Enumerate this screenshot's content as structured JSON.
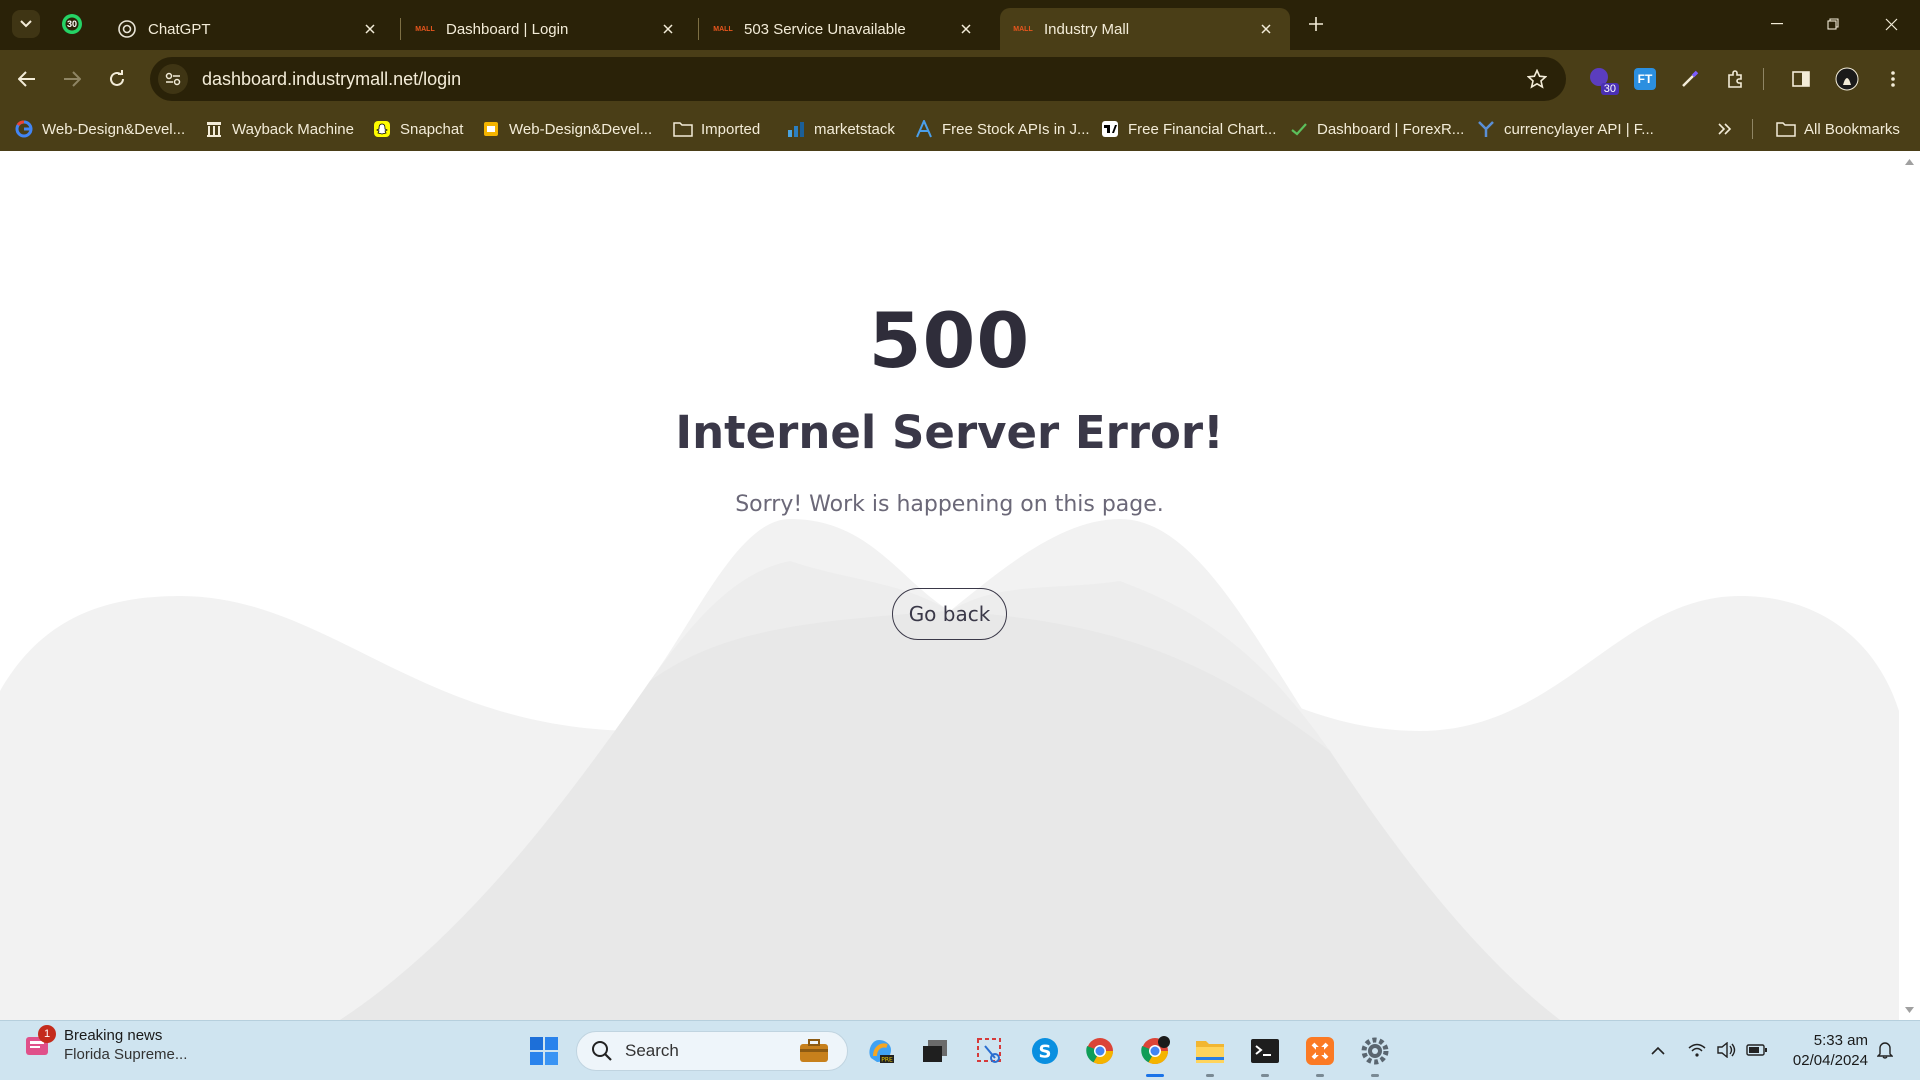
{
  "browser": {
    "pinned_tab_badge": "30",
    "tabs": [
      {
        "title": "ChatGPT",
        "icon": "chatgpt-icon"
      },
      {
        "title": "Dashboard | Login",
        "icon": "industry-mall-favicon"
      },
      {
        "title": "503 Service Unavailable",
        "icon": "industry-mall-favicon"
      },
      {
        "title": "Industry Mall",
        "icon": "industry-mall-favicon",
        "active": true
      }
    ],
    "favicon_text": "MALL",
    "url": "dashboard.industrymall.net/login",
    "extension_badge": "30",
    "extension_ft_label": "FT",
    "bookmarks": [
      {
        "label": "Web-Design&Devel...",
        "icon": "google-icon"
      },
      {
        "label": "Wayback Machine",
        "icon": "wayback-icon"
      },
      {
        "label": "Snapchat",
        "icon": "snapchat-icon"
      },
      {
        "label": "Web-Design&Devel...",
        "icon": "slides-icon"
      },
      {
        "label": "Imported",
        "icon": "folder-icon"
      },
      {
        "label": "marketstack",
        "icon": "marketstack-icon"
      },
      {
        "label": "Free Stock APIs in J...",
        "icon": "a-logo-icon"
      },
      {
        "label": "Free Financial Chart...",
        "icon": "tradingview-icon"
      },
      {
        "label": "Dashboard | ForexR...",
        "icon": "check-icon"
      },
      {
        "label": "currencylayer API | F...",
        "icon": "currencylayer-icon"
      }
    ],
    "all_bookmarks": "All Bookmarks"
  },
  "page": {
    "code": "500",
    "title": "Internel Server Error!",
    "message": "Sorry! Work is happening on this page.",
    "button": "Go back"
  },
  "taskbar": {
    "news_badge": "1",
    "news_title": "Breaking news",
    "news_sub": "Florida Supreme...",
    "search_label": "Search",
    "time": "5:33 am",
    "date": "02/04/2024"
  },
  "colors": {
    "chrome_frame": "#2a2208",
    "chrome_toolbar": "#4a3e17",
    "heading": "#2f2d3a",
    "wave_light": "#f2f2f2",
    "wave_dark": "#e6e6e6",
    "taskbar": "#cfe4f0"
  }
}
